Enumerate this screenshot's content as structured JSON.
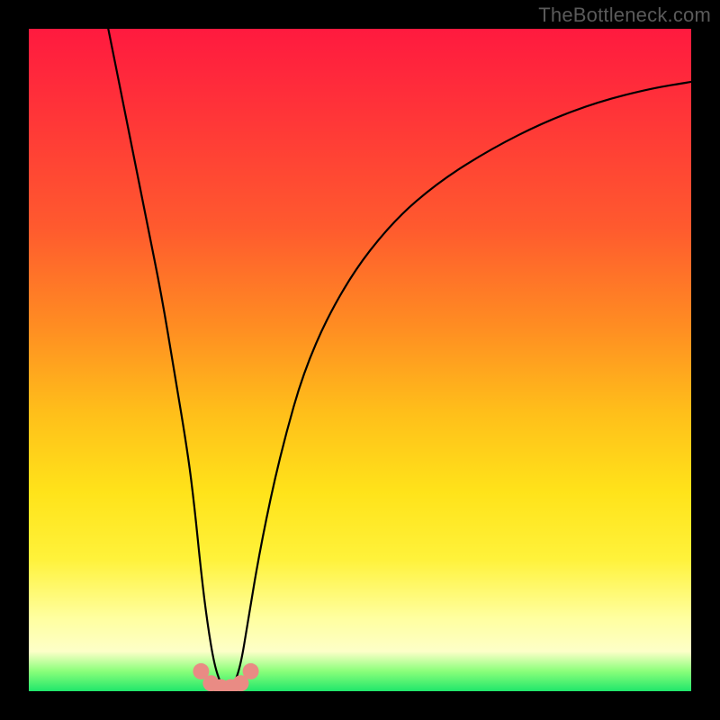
{
  "watermark": "TheBottleneck.com",
  "chart_data": {
    "type": "line",
    "title": "",
    "xlabel": "",
    "ylabel": "",
    "xlim": [
      0,
      100
    ],
    "ylim": [
      0,
      100
    ],
    "grid": false,
    "legend": false,
    "series": [
      {
        "name": "bottleneck-curve",
        "color": "#000000",
        "x": [
          12,
          14,
          16,
          18,
          20,
          22,
          24,
          25,
          26,
          27,
          28,
          29,
          30,
          31,
          32,
          33,
          35,
          38,
          42,
          48,
          55,
          62,
          70,
          78,
          86,
          94,
          100
        ],
        "y": [
          100,
          90,
          80,
          70,
          60,
          48,
          36,
          28,
          18,
          10,
          4,
          1,
          0.5,
          1,
          4,
          10,
          22,
          36,
          50,
          62,
          71,
          77,
          82,
          86,
          89,
          91,
          92
        ]
      }
    ],
    "markers": [
      {
        "x": 26.0,
        "y": 3.0
      },
      {
        "x": 27.5,
        "y": 1.2
      },
      {
        "x": 29.0,
        "y": 0.6
      },
      {
        "x": 30.5,
        "y": 0.6
      },
      {
        "x": 32.0,
        "y": 1.2
      },
      {
        "x": 33.5,
        "y": 3.0
      }
    ],
    "marker_color": "#e98b84",
    "marker_radius": 9
  }
}
